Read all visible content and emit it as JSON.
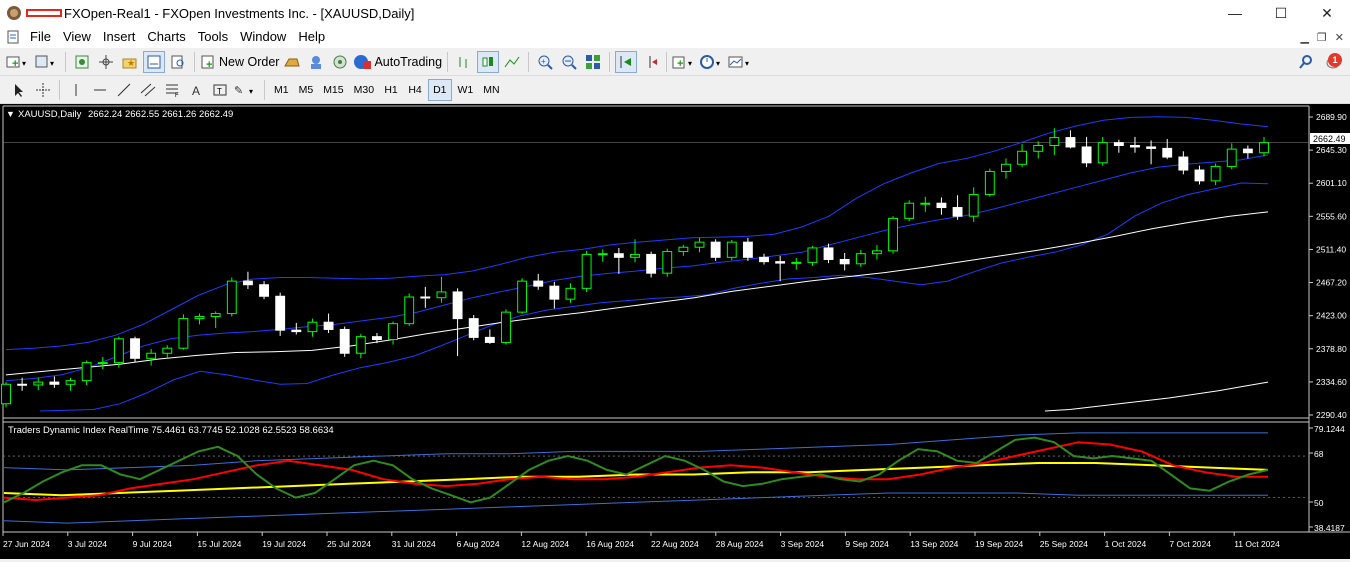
{
  "window": {
    "title": "FXOpen-Real1 - FXOpen Investments Inc. - [XAUUSD,Daily]",
    "minimize": "—",
    "maximize": "☐",
    "close": "✕"
  },
  "menu": {
    "items": [
      "File",
      "View",
      "Insert",
      "Charts",
      "Tools",
      "Window",
      "Help"
    ]
  },
  "toolbar": {
    "new_order_label": "New Order",
    "autotrading_label": "AutoTrading",
    "timeframes": [
      "M1",
      "M5",
      "M15",
      "M30",
      "H1",
      "H4",
      "D1",
      "W1",
      "MN"
    ],
    "active_timeframe": "D1",
    "notification_count": "1"
  },
  "chart": {
    "symbol_label": "XAUUSD,Daily",
    "ohlc_label": "2662.24 2662.55 2661.26 2662.49",
    "current_price_label": "2662.49",
    "indicator_label": "Traders Dynamic Index RealTime 75.4461 63.7745 52.1028 62.5523 58.6634",
    "colors": {
      "background": "#000000",
      "bull_body": "#000000",
      "bull_outline": "#00ff00",
      "bear_body": "#ffffff",
      "bollinger": "#1c3cff",
      "ma": "#ffffff",
      "tdi_green": "#2e8b1e",
      "tdi_red": "#ff0000",
      "tdi_yellow": "#ffff00",
      "tdi_bands": "#3a6fd8"
    }
  },
  "chart_data": {
    "type": "candlestick",
    "price_axis_ticks": [
      "2689.90",
      "2645.30",
      "2601.10",
      "2555.60",
      "2511.40",
      "2467.20",
      "2423.00",
      "2378.80",
      "2334.60",
      "2290.40"
    ],
    "indicator_axis_ticks": [
      "79.1244",
      "68",
      "50",
      "38.4187"
    ],
    "date_labels": [
      "27 Jun 2024",
      "3 Jul 2024",
      "9 Jul 2024",
      "15 Jul 2024",
      "19 Jul 2024",
      "25 Jul 2024",
      "31 Jul 2024",
      "6 Aug 2024",
      "12 Aug 2024",
      "16 Aug 2024",
      "22 Aug 2024",
      "28 Aug 2024",
      "3 Sep 2024",
      "9 Sep 2024",
      "13 Sep 2024",
      "19 Sep 2024",
      "25 Sep 2024",
      "1 Oct 2024",
      "7 Oct 2024",
      "11 Oct 2024"
    ],
    "price_ylim": [
      2283,
      2710
    ],
    "indicator_ylim": [
      36,
      81
    ],
    "candles_ohlc": [
      [
        2300,
        2330,
        2295,
        2327
      ],
      [
        2327,
        2336,
        2318,
        2326
      ],
      [
        2326,
        2336,
        2319,
        2330
      ],
      [
        2330,
        2338,
        2322,
        2327
      ],
      [
        2327,
        2336,
        2318,
        2332
      ],
      [
        2332,
        2360,
        2326,
        2357
      ],
      [
        2357,
        2365,
        2348,
        2357
      ],
      [
        2357,
        2393,
        2350,
        2390
      ],
      [
        2390,
        2393,
        2358,
        2363
      ],
      [
        2363,
        2376,
        2353,
        2370
      ],
      [
        2370,
        2381,
        2362,
        2377
      ],
      [
        2377,
        2424,
        2375,
        2418
      ],
      [
        2418,
        2425,
        2410,
        2421
      ],
      [
        2421,
        2428,
        2405,
        2425
      ],
      [
        2425,
        2475,
        2421,
        2470
      ],
      [
        2470,
        2483,
        2459,
        2465
      ],
      [
        2465,
        2470,
        2445,
        2449
      ],
      [
        2449,
        2454,
        2394,
        2402
      ],
      [
        2402,
        2412,
        2396,
        2400
      ],
      [
        2400,
        2418,
        2393,
        2413
      ],
      [
        2413,
        2425,
        2398,
        2403
      ],
      [
        2403,
        2407,
        2365,
        2370
      ],
      [
        2370,
        2397,
        2363,
        2393
      ],
      [
        2393,
        2398,
        2384,
        2389
      ],
      [
        2389,
        2414,
        2382,
        2411
      ],
      [
        2411,
        2453,
        2408,
        2448
      ],
      [
        2448,
        2462,
        2433,
        2447
      ],
      [
        2447,
        2476,
        2440,
        2455
      ],
      [
        2455,
        2460,
        2366,
        2418
      ],
      [
        2418,
        2423,
        2388,
        2392
      ],
      [
        2392,
        2403,
        2383,
        2385
      ],
      [
        2385,
        2431,
        2382,
        2427
      ],
      [
        2427,
        2474,
        2425,
        2470
      ],
      [
        2470,
        2480,
        2458,
        2463
      ],
      [
        2463,
        2469,
        2432,
        2445
      ],
      [
        2445,
        2467,
        2440,
        2460
      ],
      [
        2460,
        2512,
        2455,
        2507
      ],
      [
        2507,
        2514,
        2497,
        2508
      ],
      [
        2508,
        2516,
        2480,
        2503
      ],
      [
        2503,
        2528,
        2496,
        2507
      ],
      [
        2507,
        2511,
        2475,
        2481
      ],
      [
        2481,
        2515,
        2476,
        2511
      ],
      [
        2511,
        2520,
        2505,
        2517
      ],
      [
        2517,
        2530,
        2510,
        2524
      ],
      [
        2524,
        2528,
        2498,
        2503
      ],
      [
        2503,
        2527,
        2499,
        2524
      ],
      [
        2524,
        2530,
        2498,
        2503
      ],
      [
        2503,
        2508,
        2493,
        2497
      ],
      [
        2497,
        2505,
        2470,
        2495
      ],
      [
        2495,
        2502,
        2486,
        2496
      ],
      [
        2496,
        2519,
        2491,
        2516
      ],
      [
        2516,
        2522,
        2495,
        2500
      ],
      [
        2500,
        2509,
        2485,
        2494
      ],
      [
        2494,
        2513,
        2490,
        2508
      ],
      [
        2508,
        2520,
        2500,
        2512
      ],
      [
        2512,
        2560,
        2508,
        2557
      ],
      [
        2557,
        2582,
        2553,
        2578
      ],
      [
        2578,
        2587,
        2566,
        2578
      ],
      [
        2578,
        2586,
        2562,
        2572
      ],
      [
        2572,
        2589,
        2555,
        2560
      ],
      [
        2560,
        2600,
        2552,
        2590
      ],
      [
        2590,
        2626,
        2587,
        2622
      ],
      [
        2622,
        2640,
        2612,
        2632
      ],
      [
        2632,
        2660,
        2628,
        2650
      ],
      [
        2650,
        2664,
        2640,
        2658
      ],
      [
        2658,
        2682,
        2645,
        2669
      ],
      [
        2669,
        2679,
        2654,
        2656
      ],
      [
        2656,
        2670,
        2628,
        2634
      ],
      [
        2634,
        2670,
        2630,
        2662
      ],
      [
        2662,
        2666,
        2648,
        2658
      ],
      [
        2658,
        2670,
        2648,
        2656
      ],
      [
        2656,
        2665,
        2632,
        2654
      ],
      [
        2654,
        2667,
        2639,
        2642
      ],
      [
        2642,
        2650,
        2618,
        2624
      ],
      [
        2624,
        2630,
        2604,
        2609
      ],
      [
        2609,
        2633,
        2603,
        2629
      ],
      [
        2629,
        2661,
        2625,
        2653
      ],
      [
        2653,
        2658,
        2640,
        2648
      ],
      [
        2648,
        2670,
        2643,
        2662
      ]
    ],
    "series": [
      {
        "name": "Bollinger upper",
        "values": [
          2375,
          2377,
          2380,
          2385,
          2395,
          2410,
          2430,
          2450,
          2465,
          2473,
          2475,
          2475,
          2474,
          2473,
          2474,
          2477,
          2479,
          2484,
          2493,
          2503,
          2510,
          2514,
          2520,
          2524,
          2527,
          2530,
          2531,
          2532,
          2535,
          2545,
          2560,
          2585,
          2605,
          2620,
          2633,
          2640,
          2650,
          2662,
          2675,
          2685,
          2693,
          2697,
          2698,
          2697,
          2693,
          2688,
          2684
        ]
      },
      {
        "name": "Bollinger middle",
        "values": [
          2332,
          2335,
          2340,
          2350,
          2365,
          2380,
          2390,
          2395,
          2398,
          2400,
          2403,
          2407,
          2410,
          2415,
          2420,
          2427,
          2437,
          2447,
          2455,
          2463,
          2471,
          2477,
          2481,
          2484,
          2488,
          2491,
          2496,
          2500,
          2505,
          2510,
          2520,
          2530,
          2540,
          2548,
          2555,
          2561,
          2570,
          2580,
          2590,
          2600,
          2610,
          2620,
          2628,
          2632,
          2635,
          2638,
          2645
        ]
      },
      {
        "name": "Bollinger lower",
        "values": [
          2290,
          2291,
          2292,
          2300,
          2315,
          2333,
          2345,
          2340,
          2333,
          2327,
          2328,
          2340,
          2350,
          2357,
          2366,
          2380,
          2395,
          2410,
          2422,
          2430,
          2435,
          2440,
          2443,
          2446,
          2448,
          2451,
          2460,
          2467,
          2473,
          2475,
          2478,
          2475,
          2470,
          2465,
          2470,
          2483,
          2495,
          2503,
          2510,
          2520,
          2535,
          2560,
          2578,
          2590,
          2598,
          2606,
          2605
        ]
      },
      {
        "name": "Moving average",
        "values": [
          2340,
          2345,
          2350,
          2355,
          2362,
          2367,
          2371,
          2372,
          2374,
          2380,
          2388,
          2397,
          2405,
          2413,
          2420,
          2426,
          2433,
          2440,
          2447,
          2456,
          2463,
          2470,
          2476,
          2482,
          2489,
          2497,
          2505,
          2513,
          2522,
          2532,
          2543,
          2552,
          2560,
          2566
        ]
      },
      {
        "name": "Long moving average",
        "values": [
          2290,
          2292,
          2296,
          2300,
          2304,
          2308,
          2313,
          2318,
          2324,
          2330
        ]
      },
      {
        "name": "TDI RSI price line",
        "values": [
          48,
          52,
          57,
          61,
          64,
          64,
          60,
          58,
          62,
          66,
          70,
          72,
          68,
          60,
          54,
          50,
          52,
          58,
          64,
          66,
          64,
          58,
          54,
          51,
          48,
          50,
          56,
          62,
          66,
          68,
          66,
          62,
          60,
          64,
          68,
          66,
          62,
          57,
          55,
          56,
          58,
          59,
          60,
          58,
          57,
          60,
          66,
          71,
          70,
          66,
          65,
          70,
          75,
          76,
          74,
          68,
          67,
          68,
          67,
          66,
          60,
          54,
          53,
          57,
          60,
          62
        ]
      },
      {
        "name": "TDI signal line",
        "values": [
          50,
          49,
          50,
          51,
          54,
          56,
          58,
          61,
          64,
          66,
          64,
          62,
          58,
          56,
          55,
          56,
          58,
          59,
          58,
          58,
          59,
          61,
          63,
          64,
          63,
          61,
          59,
          58,
          58,
          60,
          63,
          65,
          68,
          71,
          74,
          73,
          70,
          64,
          61,
          59,
          59
        ]
      },
      {
        "name": "TDI market base line",
        "values": [
          52,
          51,
          52,
          53,
          54,
          55,
          56,
          57,
          58,
          59,
          59,
          60,
          60,
          61,
          61,
          62,
          63,
          64,
          65,
          65,
          64,
          63,
          62
        ]
      },
      {
        "name": "TDI volatility band upper",
        "values": [
          63,
          62,
          63,
          64,
          66,
          67,
          68,
          69,
          69,
          70,
          70,
          70,
          71,
          72,
          73,
          75,
          77,
          78,
          78,
          78,
          78
        ]
      },
      {
        "name": "TDI volatility band lower",
        "values": [
          40,
          39,
          40,
          41,
          42,
          43,
          44,
          45,
          46,
          47,
          48,
          49,
          50,
          51,
          52,
          52,
          52,
          51,
          51,
          51,
          51
        ]
      }
    ]
  }
}
